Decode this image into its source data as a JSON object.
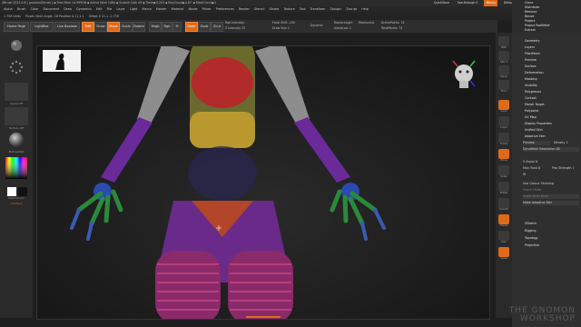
{
  "titlebar": {
    "text": "ZBrush 2022.0.6 [ gnomonZbrush ]     ▪ Free Mem 14.999GB ▪ Active Mem 1484 ▪ Scratch Disk 49 ▪ Timer▶0.203 ▪ PolyCount▶4.67' ▪ MeshCount▶1",
    "quicksave": "QuickSave",
    "seethrough": "See-through 0",
    "menus_label": "Menus",
    "script": "DefaultZScript"
  },
  "menubar": [
    "Alpha",
    "Brush",
    "Color",
    "Document",
    "Draw",
    "Dynamics",
    "Edit",
    "File",
    "Layer",
    "Light",
    "Macro",
    "Marker",
    "Material",
    "Movie",
    "Picker",
    "Preferences",
    "Render",
    "Stencil",
    "Stroke",
    "Texture",
    "Tool",
    "Transform",
    "Zplugin",
    "Zscript",
    "Help"
  ],
  "infobar": {
    "a": "1.758 Units",
    "b": "Pivots 3042 Angle -16 Position 0.11,1.1",
    "c": "Offset 0 11,1 -1.759"
  },
  "toolbar": {
    "home_page": "Home Page",
    "lightbox": "LightBox",
    "live_boolean": "Live Boolean",
    "edit": "Edit",
    "draw": "Draw",
    "move": "Move",
    "scale": "Scale",
    "rotate": "Rotate",
    "mrgb": "Mrgb",
    "rgb": "Rgb",
    "m": "M",
    "zadd": "Zadd",
    "zsub": "Zsub",
    "zcut": "Zcut",
    "focal_shift": "Focal Shift -100",
    "draw_size": "Draw Size 1",
    "rgb_intensity": "Rgb Intensity",
    "z_intensity": "Z Intensity 25",
    "dynamic": "Dynamic",
    "replacelight": "ReplaceLight",
    "replace_lst": "ReplaceLst",
    "active_points": "ActivePoints: 74",
    "total_points": "TotalPoints: 74",
    "alpha_lod": "AlphaLod: 1"
  },
  "left_shelf": {
    "alpha_off": "Alpha Off",
    "texture_off": "Texture Off",
    "matcap": "MatcapRed",
    "switch_color": "SwitchColor",
    "gradient": "Gradient"
  },
  "right_shelf": [
    "BPR",
    "SPix 3",
    "Persp",
    "Floor",
    "Local",
    "L.Sym",
    "Frame",
    "Move",
    "Scale",
    "Rotate",
    "Line Fill",
    "Transp",
    "Solo",
    "Xpose"
  ],
  "tray": {
    "top_items": [
      "Clone",
      "Distribute",
      "Remove",
      "Resize",
      "Project",
      "Project BasRelief",
      "Extract"
    ],
    "sections": [
      "Geometry",
      "Layers",
      "FiberMesh",
      "Preview",
      "Surface",
      "Deformation",
      "Masking",
      "Visibility",
      "Polygroups",
      "Contact",
      "Morph Target",
      "Polypaint",
      "UV Map",
      "Display Properties",
      "Unified Skin",
      "Adaptive Skin"
    ],
    "adaptive": {
      "preview": "Preview",
      "density": "Density 2",
      "dynamesh_res": "DynaMesh Resolution 80",
      "g_equal": "G.Equal 8",
      "max_twist": "Max Twist 8",
      "proj_strength": "Proj Strength 1",
      "ir": "IR",
      "use_classic": "Use Classic Skinning",
      "match_mode": "Match Mode",
      "insert_disabled": "Insert Multi-Mesh",
      "make_adaptive": "Make Adaptive Skin"
    },
    "bottom_sections": [
      "ZSketch",
      "Rigging",
      "Topology",
      "Projection"
    ]
  },
  "watermark": {
    "line1": "THE GNOMON",
    "line2": "WORKSHOP"
  }
}
